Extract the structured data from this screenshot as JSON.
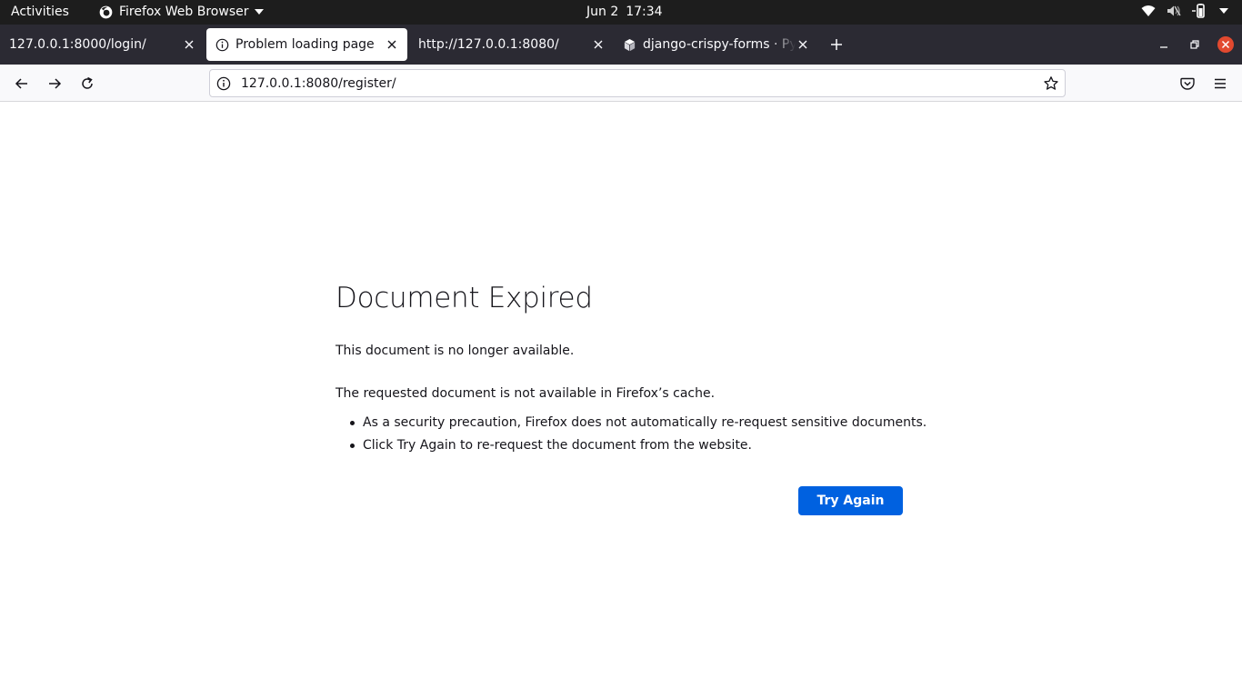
{
  "topbar": {
    "activities": "Activities",
    "app_name": "Firefox Web Browser",
    "date": "Jun 2",
    "time": "17:34"
  },
  "tabs": [
    {
      "title": "127.0.0.1:8000/login/",
      "favicon": "none",
      "selected": false
    },
    {
      "title": "Problem loading page",
      "favicon": "info-icon",
      "selected": true
    },
    {
      "title": "http://127.0.0.1:8080/",
      "favicon": "none",
      "selected": false
    },
    {
      "title": "django-crispy-forms · PyPI",
      "favicon": "pypi-cube-icon",
      "selected": false
    }
  ],
  "urlbar": {
    "url": "127.0.0.1:8080/register/"
  },
  "error_page": {
    "title": "Document Expired",
    "short_desc": "This document is no longer available.",
    "long_desc": "The requested document is not available in Firefox’s cache.",
    "bullets": [
      "As a security precaution, Firefox does not automatically re-request sensitive documents.",
      "Click Try Again to re-request the document from the website."
    ],
    "button": "Try Again"
  },
  "colors": {
    "topbar_bg": "#1d1d1d",
    "tabstrip_bg": "#2b2a33",
    "navbar_bg": "#f9f9fb",
    "accent_button": "#0061e0",
    "close_window_red": "#e2492f"
  }
}
